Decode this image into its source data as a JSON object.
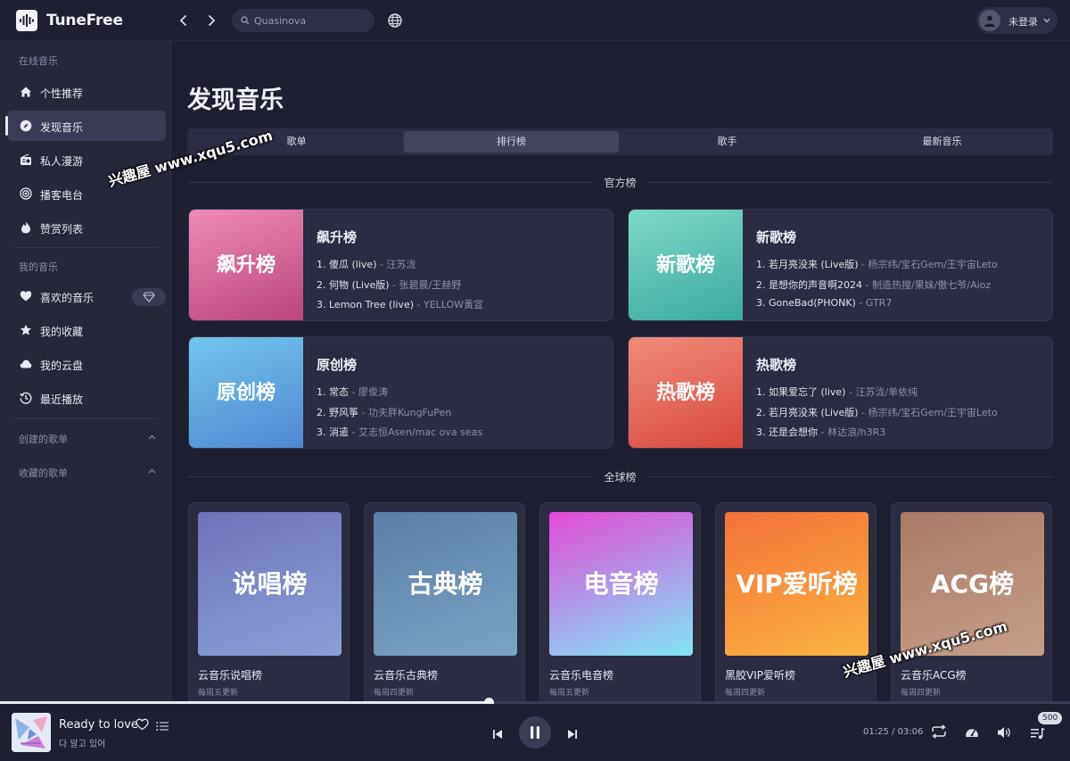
{
  "app": {
    "title": "TuneFree"
  },
  "header": {
    "search_placeholder": "Quasinova",
    "user_label": "未登录"
  },
  "sidebar": {
    "online_section": "在线音乐",
    "online_items": [
      {
        "label": "个性推荐",
        "icon": "home-icon"
      },
      {
        "label": "发现音乐",
        "icon": "compass-icon",
        "active": true
      },
      {
        "label": "私人漫游",
        "icon": "radio-icon"
      },
      {
        "label": "播客电台",
        "icon": "podcast-icon"
      },
      {
        "label": "赞赏列表",
        "icon": "flame-icon"
      }
    ],
    "my_section": "我的音乐",
    "my_items": [
      {
        "label": "喜欢的音乐",
        "icon": "heart-icon"
      },
      {
        "label": "我的收藏",
        "icon": "star-icon"
      },
      {
        "label": "我的云盘",
        "icon": "cloud-icon"
      },
      {
        "label": "最近播放",
        "icon": "history-icon"
      }
    ],
    "created_playlists": "创建的歌单",
    "collected_playlists": "收藏的歌单"
  },
  "main": {
    "title": "发现音乐",
    "tabs": [
      {
        "label": "歌单"
      },
      {
        "label": "排行榜",
        "active": true
      },
      {
        "label": "歌手"
      },
      {
        "label": "最新音乐"
      }
    ],
    "official_section": "官方榜",
    "official_charts": [
      {
        "name": "飙升榜",
        "cover": "飙升榜",
        "color_from": "#f08bb5",
        "color_to": "#b8457a",
        "tracks": [
          {
            "num": "1.",
            "title": "傻瓜 (live)",
            "artist": "汪苏泷"
          },
          {
            "num": "2.",
            "title": "何物 (Live版)",
            "artist": "张碧晨/王赫野"
          },
          {
            "num": "3.",
            "title": "Lemon Tree (live)",
            "artist": "YELLOW黃宣"
          }
        ]
      },
      {
        "name": "新歌榜",
        "cover": "新歌榜",
        "color_from": "#7fd9c6",
        "color_to": "#3aa99e",
        "tracks": [
          {
            "num": "1.",
            "title": "若月亮没来 (Live版)",
            "artist": "杨宗纬/宝石Gem/王宇宙Leto"
          },
          {
            "num": "2.",
            "title": "是想你的声音啊2024",
            "artist": "制造热搜/果妹/傲七爷/Aioz"
          },
          {
            "num": "3.",
            "title": "GoneBad(PHONK)",
            "artist": "GTR7"
          }
        ]
      },
      {
        "name": "原创榜",
        "cover": "原创榜",
        "color_from": "#73c7ec",
        "color_to": "#4f86d4",
        "tracks": [
          {
            "num": "1.",
            "title": "常态",
            "artist": "廖俊涛"
          },
          {
            "num": "2.",
            "title": "野风筝",
            "artist": "功夫胖KungFuPen"
          },
          {
            "num": "3.",
            "title": "消遣",
            "artist": "艾志恒Asen/mac ova seas"
          }
        ]
      },
      {
        "name": "热歌榜",
        "cover": "热歌榜",
        "color_from": "#f08c7a",
        "color_to": "#d9473e",
        "tracks": [
          {
            "num": "1.",
            "title": "如果爱忘了 (live)",
            "artist": "汪苏泷/单依纯"
          },
          {
            "num": "2.",
            "title": "若月亮没来 (Live版)",
            "artist": "杨宗纬/宝石Gem/王宇宙Leto"
          },
          {
            "num": "3.",
            "title": "还是会想你",
            "artist": "林达浪/h3R3"
          }
        ]
      }
    ],
    "global_section": "全球榜",
    "global_charts": [
      {
        "cover": "说唱榜",
        "name": "云音乐说唱榜",
        "update": "每周五更新",
        "color_from": "#6f73b8",
        "color_to": "#8aa0d6"
      },
      {
        "cover": "古典榜",
        "name": "云音乐古典榜",
        "update": "每周四更新",
        "color_from": "#5a7fa8",
        "color_to": "#7aa3c4"
      },
      {
        "cover": "电音榜",
        "name": "云音乐电音榜",
        "update": "每周五更新",
        "color_from": "#e34ad8",
        "color_to": "#7fe6f5"
      },
      {
        "cover": "VIP爱听榜",
        "name": "黑胶VIP爱听榜",
        "update": "每周四更新",
        "color_from": "#f5713b",
        "color_to": "#f9b440"
      },
      {
        "cover": "ACG榜",
        "name": "云音乐ACG榜",
        "update": "每周四更新",
        "color_from": "#a87966",
        "color_to": "#c7a089"
      }
    ]
  },
  "watermark": "兴趣屋 www.xqu5.com",
  "player": {
    "song_title": "Ready to love",
    "song_artist": "다 알고 있어",
    "current_time": "01:25",
    "total_time": "03:06",
    "time_separator": " / ",
    "progress": 0.457,
    "volume": "500"
  }
}
